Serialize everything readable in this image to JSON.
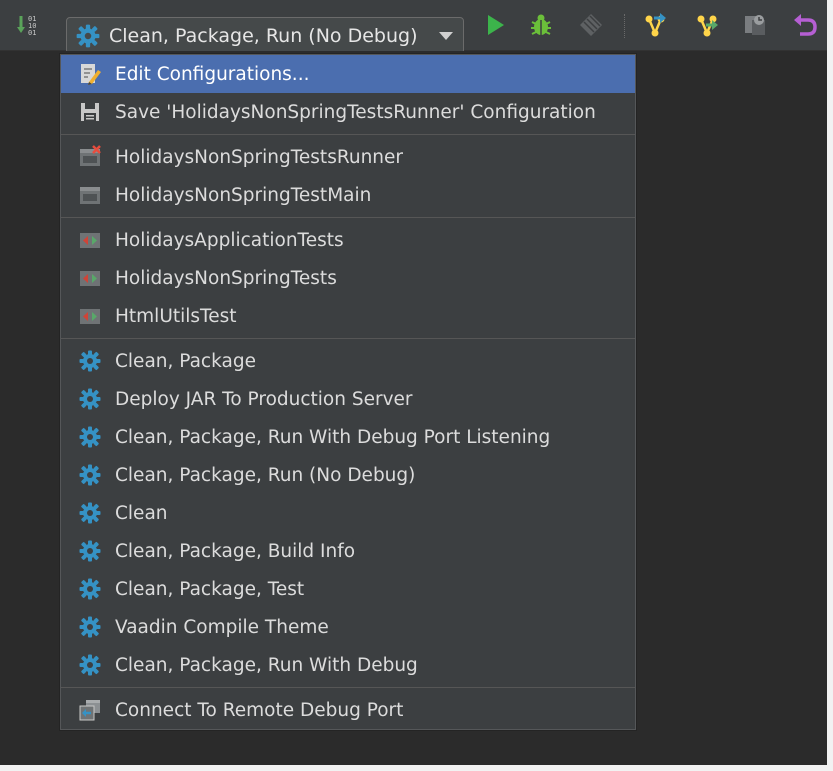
{
  "toolbar": {
    "run_config_selected": "Clean, Package, Run (No Debug)",
    "icons": [
      "sort-binary-icon",
      "gear-icon",
      "run-icon",
      "debug-icon",
      "coverage-icon",
      "vcs-update-icon",
      "vcs-commit-icon",
      "vcs-compare-icon",
      "undo-icon"
    ]
  },
  "menu": {
    "top_actions": [
      {
        "label": "Edit Configurations...",
        "icon": "edit-config-icon",
        "selected": true
      },
      {
        "label": "Save 'HolidaysNonSpringTestsRunner' Configuration",
        "icon": "save-icon",
        "selected": false
      }
    ],
    "app_configs": [
      {
        "label": "HolidaysNonSpringTestsRunner",
        "icon": "app-error-icon"
      },
      {
        "label": "HolidaysNonSpringTestMain",
        "icon": "app-icon"
      }
    ],
    "test_configs": [
      {
        "label": "HolidaysApplicationTests",
        "icon": "test-icon"
      },
      {
        "label": "HolidaysNonSpringTests",
        "icon": "test-icon"
      },
      {
        "label": "HtmlUtilsTest",
        "icon": "test-icon"
      }
    ],
    "maven_configs": [
      {
        "label": "Clean, Package",
        "icon": "gear-icon"
      },
      {
        "label": "Deploy JAR To Production Server",
        "icon": "gear-icon"
      },
      {
        "label": "Clean, Package, Run With Debug Port Listening",
        "icon": "gear-icon"
      },
      {
        "label": "Clean, Package, Run (No Debug)",
        "icon": "gear-icon"
      },
      {
        "label": "Clean",
        "icon": "gear-icon"
      },
      {
        "label": "Clean, Package, Build Info",
        "icon": "gear-icon"
      },
      {
        "label": "Clean, Package, Test",
        "icon": "gear-icon"
      },
      {
        "label": "Vaadin Compile Theme",
        "icon": "gear-icon"
      },
      {
        "label": "Clean, Package, Run With Debug",
        "icon": "gear-icon"
      }
    ],
    "remote_configs": [
      {
        "label": "Connect To Remote Debug Port",
        "icon": "remote-debug-icon"
      }
    ]
  },
  "colors": {
    "background": "#2b2b2b",
    "popup": "#3c3f41",
    "selection": "#4b6eaf",
    "gear": "#3592c4",
    "run": "#59a869",
    "debug": "#6aa84f"
  }
}
